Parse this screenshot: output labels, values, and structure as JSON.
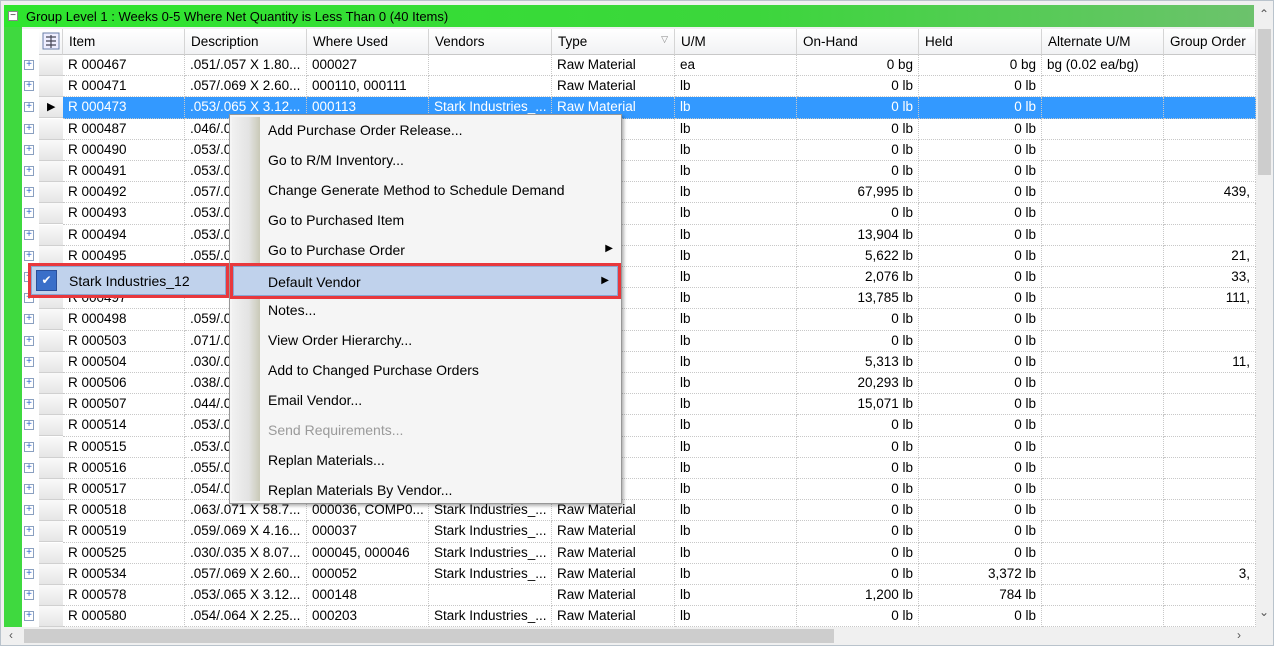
{
  "group": {
    "title": "Group Level 1 : Weeks 0-5 Where Net Quantity is Less Than 0 (40 Items)",
    "toggle": "−"
  },
  "columns": [
    "Item",
    "Description",
    "Where Used",
    "Vendors",
    "Type",
    "U/M",
    "On-Hand",
    "Held",
    "Alternate U/M",
    "Group Order"
  ],
  "rows": [
    [
      "R 000467",
      ".051/.057 X 1.80...",
      "000027",
      "",
      "Raw Material",
      "ea",
      "0 bg",
      "0 bg",
      "bg (0.02 ea/bg)",
      ""
    ],
    [
      "R 000471",
      ".057/.069 X 2.60...",
      "000110, 000111",
      "",
      "Raw Material",
      "lb",
      "0 lb",
      "0 lb",
      "",
      ""
    ],
    [
      "R 000473",
      ".053/.065 X 3.12...",
      "000113",
      "Stark Industries_...",
      "Raw Material",
      "lb",
      "0 lb",
      "0 lb",
      "",
      ""
    ],
    [
      "R 000487",
      ".046/.0",
      "",
      "",
      "ial",
      "lb",
      "0 lb",
      "0 lb",
      "",
      ""
    ],
    [
      "R 000490",
      ".053/.0",
      "",
      "",
      "ial",
      "lb",
      "0 lb",
      "0 lb",
      "",
      ""
    ],
    [
      "R 000491",
      ".053/.0",
      "",
      "",
      "ial",
      "lb",
      "0 lb",
      "0 lb",
      "",
      ""
    ],
    [
      "R 000492",
      ".057/.0",
      "",
      "",
      "ial",
      "lb",
      "67,995 lb",
      "0 lb",
      "",
      "439,"
    ],
    [
      "R 000493",
      ".053/.0",
      "",
      "",
      "ial",
      "lb",
      "0 lb",
      "0 lb",
      "",
      ""
    ],
    [
      "R 000494",
      ".053/.0",
      "",
      "",
      "ial",
      "lb",
      "13,904 lb",
      "0 lb",
      "",
      ""
    ],
    [
      "R 000495",
      ".055/.0",
      "",
      "",
      "ial",
      "lb",
      "5,622 lb",
      "0 lb",
      "",
      "21,"
    ],
    [
      "",
      "",
      "",
      "",
      "ial",
      "lb",
      "2,076 lb",
      "0 lb",
      "",
      "33,"
    ],
    [
      "R 000497",
      "",
      "",
      "",
      "ial",
      "lb",
      "13,785 lb",
      "0 lb",
      "",
      "111,"
    ],
    [
      "R 000498",
      ".059/.0",
      "",
      "",
      "ial",
      "lb",
      "0 lb",
      "0 lb",
      "",
      ""
    ],
    [
      "R 000503",
      ".071/.0",
      "",
      "",
      "ial",
      "lb",
      "0 lb",
      "0 lb",
      "",
      ""
    ],
    [
      "R 000504",
      ".030/.0",
      "",
      "",
      "ial",
      "lb",
      "5,313 lb",
      "0 lb",
      "",
      "11,"
    ],
    [
      "R 000506",
      ".038/.0",
      "",
      "",
      "ial",
      "lb",
      "20,293 lb",
      "0 lb",
      "",
      ""
    ],
    [
      "R 000507",
      ".044/.0",
      "",
      "",
      "ial",
      "lb",
      "15,071 lb",
      "0 lb",
      "",
      ""
    ],
    [
      "R 000514",
      ".053/.0",
      "",
      "",
      "ial",
      "lb",
      "0 lb",
      "0 lb",
      "",
      ""
    ],
    [
      "R 000515",
      ".053/.0",
      "",
      "",
      "ial",
      "lb",
      "0 lb",
      "0 lb",
      "",
      ""
    ],
    [
      "R 000516",
      ".055/.0",
      "",
      "",
      "ial",
      "lb",
      "0 lb",
      "0 lb",
      "",
      ""
    ],
    [
      "R 000517",
      ".054/.0",
      "",
      "",
      "ial",
      "lb",
      "0 lb",
      "0 lb",
      "",
      ""
    ],
    [
      "R 000518",
      ".063/.071 X 58.7...",
      "000036,  COMP0...",
      "Stark Industries_...",
      "Raw Material",
      "lb",
      "0 lb",
      "0 lb",
      "",
      ""
    ],
    [
      "R 000519",
      ".059/.069 X 4.16...",
      "000037",
      "Stark Industries_...",
      "Raw Material",
      "lb",
      "0 lb",
      "0 lb",
      "",
      ""
    ],
    [
      "R 000525",
      ".030/.035 X 8.07...",
      "000045, 000046",
      "Stark Industries_...",
      "Raw Material",
      "lb",
      "0 lb",
      "0 lb",
      "",
      ""
    ],
    [
      "R 000534",
      ".057/.069 X 2.60...",
      "000052",
      "Stark Industries_...",
      "Raw Material",
      "lb",
      "0 lb",
      "3,372 lb",
      "",
      "3,"
    ],
    [
      "R 000578",
      ".053/.065 X 3.12...",
      "000148",
      "",
      "Raw Material",
      "lb",
      "1,200 lb",
      "784 lb",
      "",
      ""
    ],
    [
      "R 000580",
      ".054/.064 X 2.25...",
      "000203",
      "Stark Industries_...",
      "Raw Material",
      "lb",
      "0 lb",
      "0 lb",
      "",
      ""
    ]
  ],
  "selected_row": 2,
  "context_menu": {
    "items": [
      {
        "label": "Add Purchase Order Release..."
      },
      {
        "label": "Go to R/M Inventory..."
      },
      {
        "label": "Change Generate Method to Schedule Demand"
      },
      {
        "label": "Go to Purchased Item"
      },
      {
        "label": "Go to Purchase Order",
        "submenu": true
      },
      {
        "label": "Default Vendor",
        "submenu": true,
        "highlighted": true
      },
      {
        "label": "Notes..."
      },
      {
        "label": "View Order Hierarchy..."
      },
      {
        "label": "Add to Changed Purchase Orders"
      },
      {
        "label": "Email Vendor..."
      },
      {
        "label": "Send Requirements...",
        "disabled": true
      },
      {
        "label": "Replan Materials..."
      },
      {
        "label": "Replan Materials By Vendor..."
      }
    ]
  },
  "submenu": {
    "label": "Stark Industries_12",
    "checked": true
  },
  "colors": {
    "group_bar": "#2ee52e",
    "selection": "#3399ff",
    "highlight_outline": "#e8383d",
    "menu_highlight": "#c0d2ec"
  }
}
